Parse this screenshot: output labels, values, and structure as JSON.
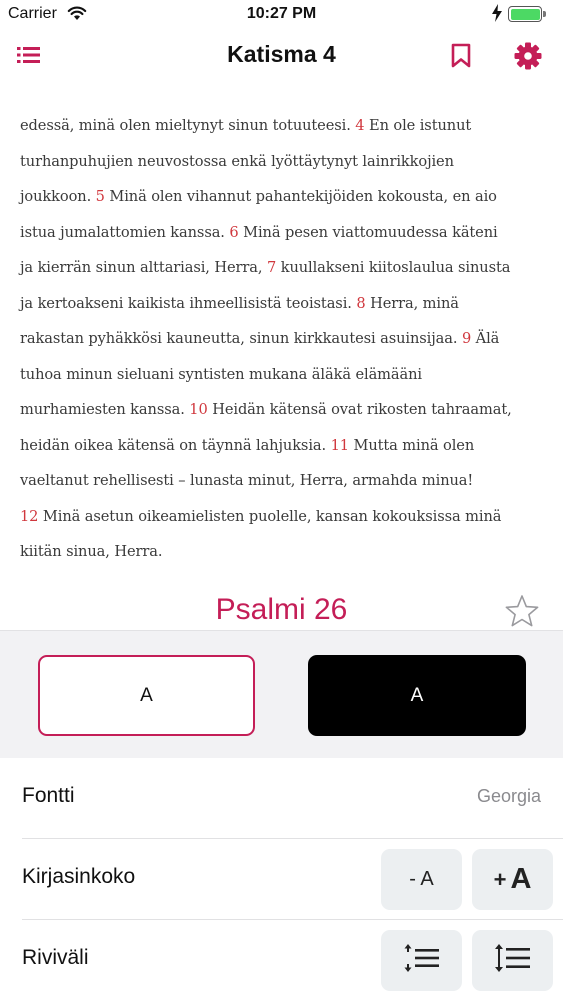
{
  "status_bar": {
    "carrier": "Carrier",
    "time": "10:27 PM",
    "battery_level": 1.0
  },
  "nav": {
    "title": "Katisma 4",
    "icons": [
      "list-menu-icon",
      "bookmark-icon",
      "gear-icon"
    ],
    "accent_color": "#c41e57"
  },
  "reading": {
    "lines": [
      [
        {
          "t": "edessä, minä olen mieltynyt sinun totuuteesi. "
        },
        {
          "t": "4",
          "v": true
        },
        {
          "t": " En ole istunut"
        }
      ],
      [
        {
          "t": "turhanpuhujien neuvostossa enkä lyöttäytynyt lainrikkojien"
        }
      ],
      [
        {
          "t": "joukkoon. "
        },
        {
          "t": "5",
          "v": true
        },
        {
          "t": " Minä olen vihannut pahantekijöiden kokousta, en aio"
        }
      ],
      [
        {
          "t": "istua jumalattomien kanssa. "
        },
        {
          "t": "6",
          "v": true
        },
        {
          "t": " Minä pesen viattomuudessa käteni"
        }
      ],
      [
        {
          "t": "ja kierrän sinun alttariasi, Herra, "
        },
        {
          "t": "7",
          "v": true
        },
        {
          "t": " kuullakseni kiitoslaulua sinusta"
        }
      ],
      [
        {
          "t": "ja kertoakseni kaikista ihmeellisistä teoistasi. "
        },
        {
          "t": "8",
          "v": true
        },
        {
          "t": " Herra, minä"
        }
      ],
      [
        {
          "t": "rakastan pyhäkkösi kauneutta, sinun kirkkautesi asuinsijaa. "
        },
        {
          "t": "9",
          "v": true
        },
        {
          "t": " Älä"
        }
      ],
      [
        {
          "t": "tuhoa minun sieluani syntisten mukana äläkä elämääni"
        }
      ],
      [
        {
          "t": "murhamiesten kanssa. "
        },
        {
          "t": "10",
          "v": true
        },
        {
          "t": " Heidän kätensä ovat rikosten tahraamat,"
        }
      ],
      [
        {
          "t": "heidän oikea kätensä on täynnä lahjuksia. "
        },
        {
          "t": "11",
          "v": true
        },
        {
          "t": " Mutta minä olen"
        }
      ],
      [
        {
          "t": "vaeltanut rehellisesti – lunasta minut, Herra, armahda minua!"
        }
      ],
      [
        {
          "t": "12",
          "v": true
        },
        {
          "t": " Minä asetun oikeamielisten puolelle, kansan kokouksissa minä"
        }
      ],
      [
        {
          "t": "kiitän sinua, Herra."
        }
      ]
    ],
    "verse_number_color": "#d0373d"
  },
  "next_section": {
    "title": "Psalmi 26",
    "favorite_icon": "star-outline-icon"
  },
  "settings": {
    "theme_light_label": "A",
    "theme_dark_label": "A",
    "selected_theme": "light",
    "font_row": {
      "label": "Fontti",
      "value": "Georgia"
    },
    "size_row": {
      "label": "Kirjasinkoko",
      "decrease": "- A",
      "increase_plus": "+",
      "increase_letter": "A"
    },
    "spacing_row": {
      "label": "Riviväli",
      "icons": [
        "line-spacing-decrease-icon",
        "line-spacing-increase-icon"
      ]
    }
  }
}
